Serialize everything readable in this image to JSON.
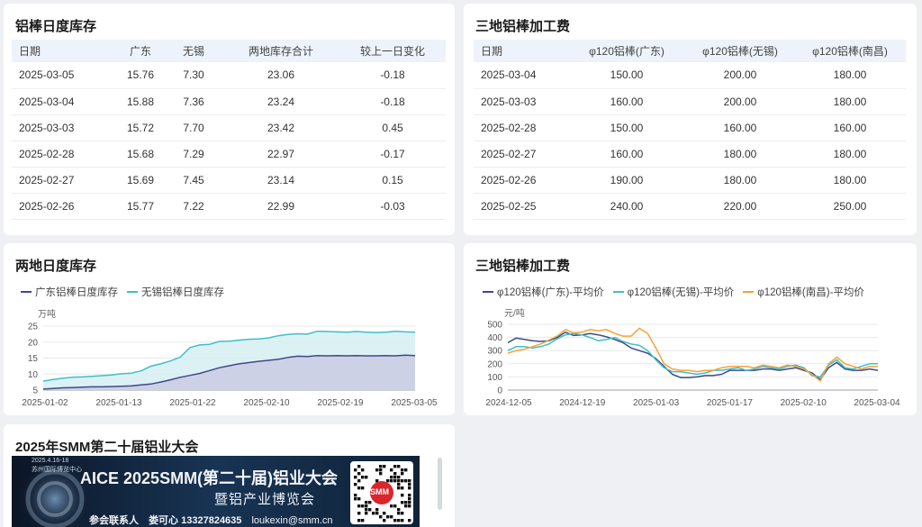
{
  "panels": {
    "stock_table": {
      "title": "铝棒日度库存",
      "headers": [
        "日期",
        "广东",
        "无锡",
        "两地库存合计",
        "较上一日变化"
      ],
      "rows": [
        [
          "2025-03-05",
          "15.76",
          "7.30",
          "23.06",
          "-0.18"
        ],
        [
          "2025-03-04",
          "15.88",
          "7.36",
          "23.24",
          "-0.18"
        ],
        [
          "2025-03-03",
          "15.72",
          "7.70",
          "23.42",
          "0.45"
        ],
        [
          "2025-02-28",
          "15.68",
          "7.29",
          "22.97",
          "-0.17"
        ],
        [
          "2025-02-27",
          "15.69",
          "7.45",
          "23.14",
          "0.15"
        ],
        [
          "2025-02-26",
          "15.77",
          "7.22",
          "22.99",
          "-0.03"
        ]
      ]
    },
    "fee_table": {
      "title": "三地铝棒加工费",
      "headers": [
        "日期",
        "φ120铝棒(广东)",
        "φ120铝棒(无锡)",
        "φ120铝棒(南昌)"
      ],
      "rows": [
        [
          "2025-03-04",
          "150.00",
          "200.00",
          "180.00"
        ],
        [
          "2025-03-03",
          "160.00",
          "200.00",
          "180.00"
        ],
        [
          "2025-02-28",
          "150.00",
          "160.00",
          "160.00"
        ],
        [
          "2025-02-27",
          "160.00",
          "180.00",
          "180.00"
        ],
        [
          "2025-02-26",
          "190.00",
          "180.00",
          "180.00"
        ],
        [
          "2025-02-25",
          "240.00",
          "220.00",
          "250.00"
        ]
      ]
    },
    "stock_chart": {
      "title": "两地日度库存",
      "unit": "万吨"
    },
    "fee_chart": {
      "title": "三地铝棒加工费",
      "unit": "元/吨"
    },
    "conference": {
      "title": "2025年SMM第二十届铝业大会",
      "banner_date": "2025.4.16-18",
      "banner_venue": "苏州国际博览中心",
      "banner_headline_left": "AICE 2025",
      "banner_headline_right": "SMM(第二十届)铝业大会",
      "banner_subline": "暨铝产业博览会",
      "banner_contact_label": "参会联系人",
      "banner_contact": "娄可心 13327824635",
      "banner_email": "loukexin@smm.cn",
      "banner_logo": "SMM"
    }
  },
  "colors": {
    "guangdong": "#3d4a8c",
    "wuxi": "#40bfc7",
    "nanchang": "#f2a33a",
    "stock_gd_fill": "#c9cbe3",
    "stock_wx_fill": "#d6eff2"
  },
  "chart_data": [
    {
      "type": "area",
      "ylabel": "万吨",
      "ylim": [
        5,
        25
      ],
      "yticks": [
        5,
        10,
        15,
        20,
        25
      ],
      "xticks": [
        "2025-01-02",
        "2025-01-13",
        "2025-01-22",
        "2025-02-10",
        "2025-02-19",
        "2025-03-05"
      ],
      "grid": true,
      "legend": "top-left",
      "series": [
        {
          "name": "广东铝棒日度库存",
          "color": "#3d4a8c",
          "values": [
            5.3,
            5.5,
            5.7,
            5.8,
            5.9,
            6.0,
            6.0,
            6.1,
            6.2,
            6.3,
            6.6,
            6.9,
            7.5,
            8.2,
            9.0,
            9.6,
            10.2,
            11.1,
            12.0,
            12.6,
            13.2,
            13.6,
            14.0,
            14.3,
            14.6,
            15.2,
            15.6,
            15.5,
            15.8,
            15.7,
            15.8,
            15.7,
            15.8,
            15.7,
            15.7,
            15.8,
            15.7,
            15.9,
            15.8
          ]
        },
        {
          "name": "无锡铝棒日度库存",
          "color": "#40bfc7",
          "values": [
            7.8,
            8.3,
            8.7,
            9.0,
            9.1,
            9.3,
            9.5,
            9.7,
            10.1,
            10.3,
            11.0,
            12.5,
            13.2,
            14.1,
            15.3,
            18.3,
            19.1,
            19.3,
            20.2,
            20.3,
            20.6,
            20.9,
            21.0,
            21.3,
            22.0,
            22.4,
            22.6,
            22.5,
            23.4,
            23.3,
            23.2,
            23.1,
            23.3,
            23.1,
            23.0,
            23.1,
            23.4,
            23.2,
            23.1
          ]
        }
      ]
    },
    {
      "type": "line",
      "ylabel": "元/吨",
      "ylim": [
        0,
        500
      ],
      "yticks": [
        0,
        100,
        200,
        300,
        400,
        500
      ],
      "xticks": [
        "2024-12-05",
        "2024-12-19",
        "2025-01-03",
        "2025-01-17",
        "2025-02-10",
        "2025-03-04"
      ],
      "grid": true,
      "legend": "top-left",
      "series": [
        {
          "name": "φ120铝棒(广东)-平均价",
          "color": "#3d4a8c",
          "values": [
            360,
            395,
            385,
            375,
            370,
            375,
            400,
            440,
            415,
            420,
            430,
            420,
            405,
            385,
            360,
            320,
            300,
            280,
            240,
            180,
            120,
            95,
            95,
            100,
            110,
            110,
            120,
            150,
            150,
            150,
            150,
            160,
            160,
            150,
            160,
            170,
            150,
            130,
            80,
            170,
            210,
            160,
            150,
            150,
            160,
            150
          ]
        },
        {
          "name": "φ120铝棒(无锡)-平均价",
          "color": "#40bfc7",
          "values": [
            300,
            330,
            330,
            320,
            330,
            350,
            390,
            420,
            430,
            420,
            400,
            375,
            385,
            400,
            370,
            350,
            340,
            300,
            230,
            170,
            140,
            140,
            130,
            120,
            130,
            150,
            150,
            160,
            170,
            150,
            160,
            180,
            170,
            160,
            180,
            190,
            170,
            110,
            100,
            190,
            230,
            170,
            160,
            180,
            200,
            200
          ]
        },
        {
          "name": "φ120铝棒(南昌)-平均价",
          "color": "#f2a33a",
          "values": [
            280,
            300,
            310,
            330,
            350,
            380,
            410,
            460,
            435,
            440,
            460,
            450,
            460,
            430,
            410,
            410,
            470,
            430,
            320,
            200,
            160,
            150,
            150,
            140,
            150,
            150,
            170,
            180,
            180,
            180,
            170,
            190,
            180,
            170,
            190,
            180,
            160,
            120,
            70,
            200,
            250,
            200,
            180,
            160,
            180,
            180
          ]
        }
      ]
    }
  ]
}
